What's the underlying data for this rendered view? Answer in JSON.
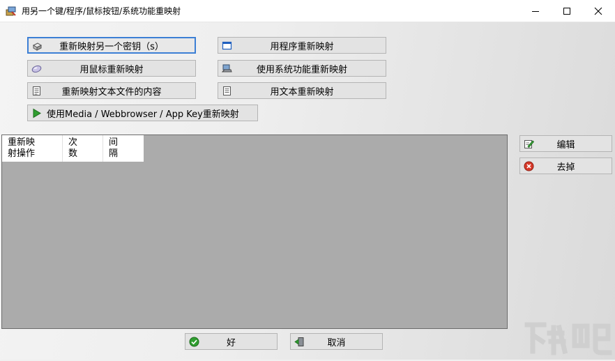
{
  "window": {
    "title": "用另一个键/程序/鼠标按钮/系统功能重映射"
  },
  "remap_buttons": {
    "key": "重新映射另一个密钥（s）",
    "program": "用程序重新映射",
    "mouse": "用鼠标重新映射",
    "system": "使用系统功能重新映射",
    "textfile": "重新映射文本文件的内容",
    "text": "用文本重新映射",
    "media": "使用Media / Webbrowser / App Key重新映射"
  },
  "list": {
    "columns": [
      {
        "line1": "重新映",
        "line2": "射操作"
      },
      {
        "line1": "次",
        "line2": "数"
      },
      {
        "line1": "间",
        "line2": "隔"
      }
    ]
  },
  "side_buttons": {
    "edit": "编辑",
    "remove": "去掉"
  },
  "footer": {
    "ok": "好",
    "cancel": "取消"
  },
  "colors": {
    "focus_border": "#3c7fd5",
    "list_background": "#ababab",
    "ok_green": "#2f9e2f",
    "remove_red": "#d83a2a"
  },
  "watermark_text": "下载吧"
}
